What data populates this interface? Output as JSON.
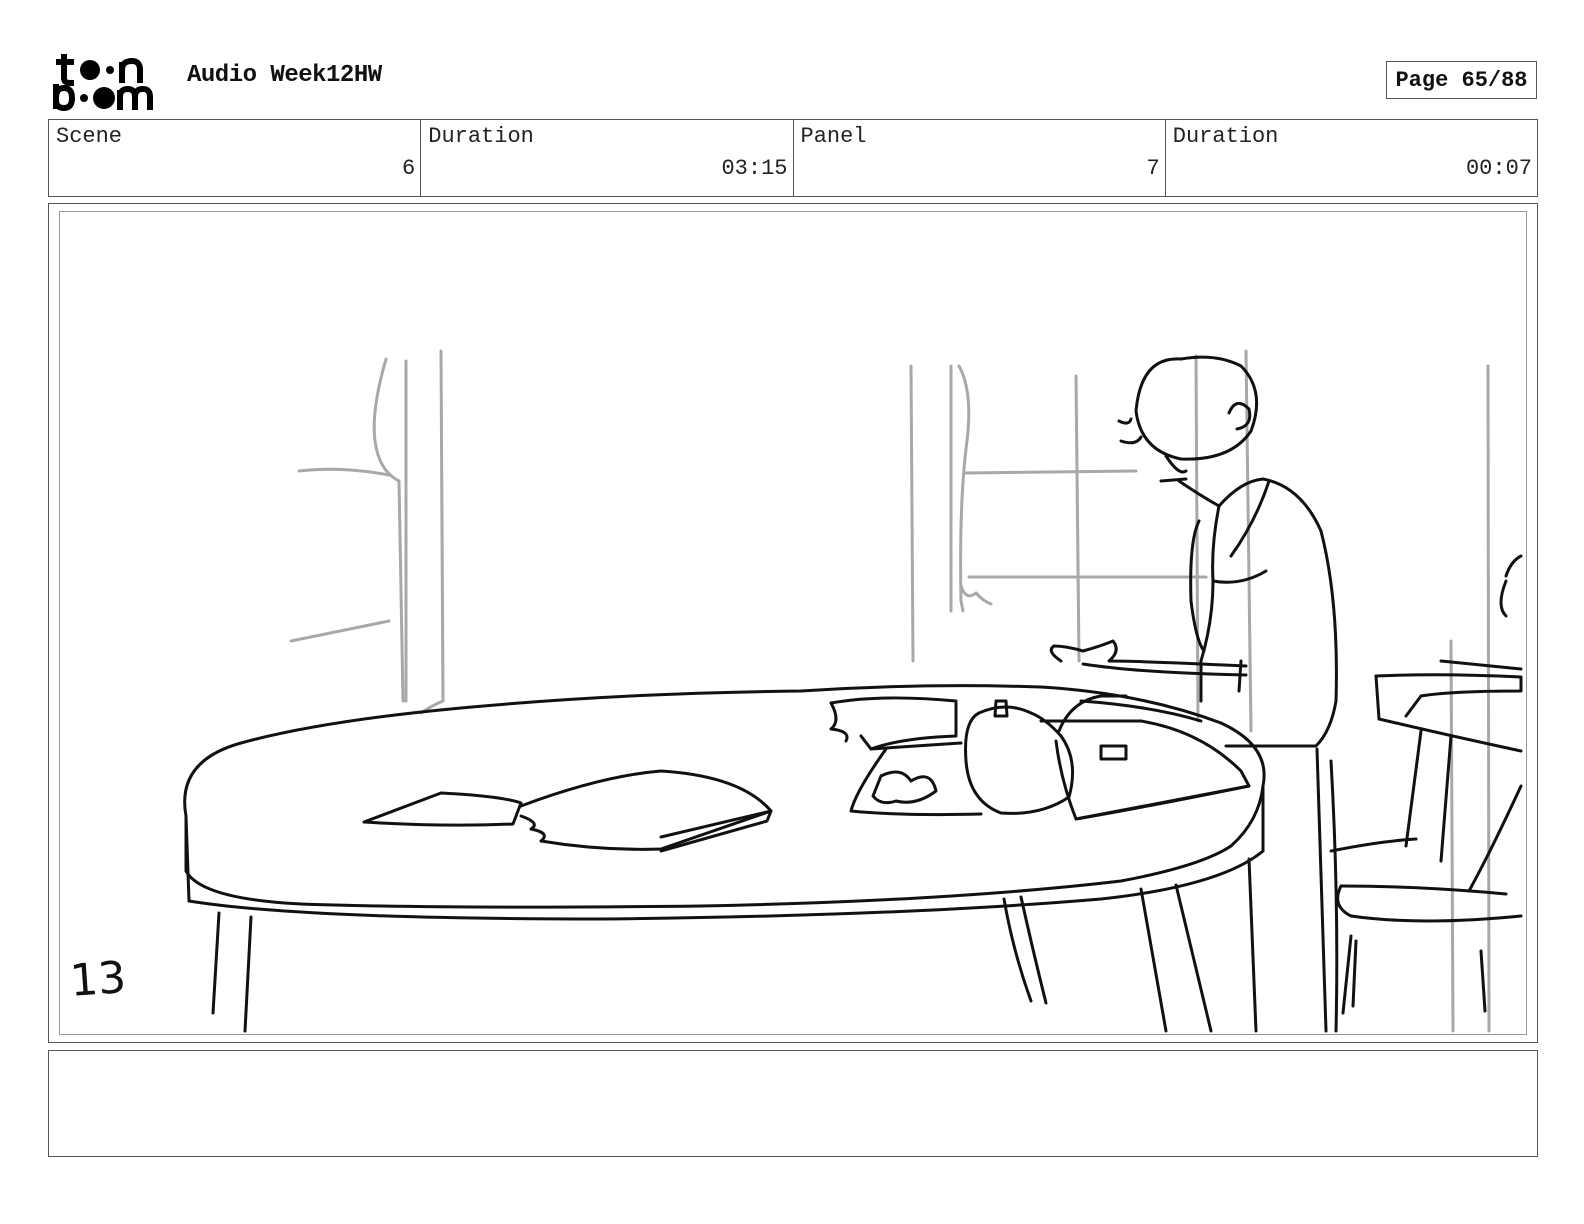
{
  "header": {
    "logo_text_top": "toon",
    "logo_text_bottom": "boom",
    "project_title": "Audio Week12HW",
    "page_label": "Page 65/88"
  },
  "info_bar": {
    "scene_label": "Scene",
    "scene_value": "6",
    "scene_duration_label": "Duration",
    "scene_duration_value": "03:15",
    "panel_label": "Panel",
    "panel_value": "7",
    "panel_duration_label": "Duration",
    "panel_duration_value": "00:07"
  },
  "panel": {
    "sketch_number": "13",
    "sketch_description_icon": "storyboard-sketch"
  },
  "caption": {
    "text": ""
  },
  "colors": {
    "border": "#555555",
    "sketch_ink": "#111111",
    "sketch_construction": "#a8a8a8"
  }
}
